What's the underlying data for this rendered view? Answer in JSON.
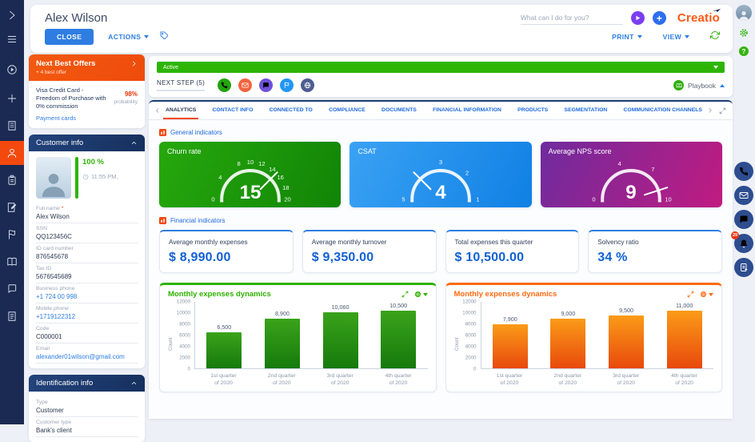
{
  "header": {
    "title": "Alex Wilson",
    "close_label": "CLOSE",
    "actions_label": "ACTIONS",
    "search_placeholder": "What can I do for you?",
    "logo_text": "Creatio",
    "print_label": "PRINT",
    "view_label": "VIEW"
  },
  "sidebar": {
    "icons": [
      "chevron-right-icon",
      "menu-icon",
      "process-play-icon",
      "add-plus-icon",
      "company-icon",
      "contact-person-icon",
      "tasks-clipboard-icon",
      "edit-document-icon",
      "flag-icon",
      "knowledge-book-icon",
      "chat-bubbles-icon",
      "invoice-file-icon"
    ],
    "active_index": 5
  },
  "right_rail": {
    "comm_icons": [
      "call-icon",
      "email-icon",
      "chat-icon",
      "notifications-bell-icon",
      "task-file-icon"
    ],
    "notification_count": "29"
  },
  "next_best_offers": {
    "title": "Next Best Offers",
    "subtitle": "+ 4 best offer",
    "offer_text": "Visa Credit Card - Freedom of Purchase with 0% commission",
    "probability_value": "98",
    "probability_unit": "%",
    "probability_label": "probability",
    "category_link": "Payment cards"
  },
  "customer_info": {
    "title": "Customer info",
    "completeness": "100 %",
    "timestamp": "11:55 PM,",
    "fields": [
      {
        "label": "Full name",
        "value": "Alex Wilson",
        "required": true
      },
      {
        "label": "SSN",
        "value": "QQ123456C"
      },
      {
        "label": "ID card number",
        "value": "876545678"
      },
      {
        "label": "Tax ID",
        "value": "5676545689"
      },
      {
        "label": "Business phone",
        "value": "+1 724 00 998",
        "link": true
      },
      {
        "label": "Mobile phone",
        "value": "+1719122312",
        "link": true
      },
      {
        "label": "Code",
        "value": "C000001"
      },
      {
        "label": "Email",
        "value": "alexander01wilson@gmail.com",
        "link": true
      }
    ]
  },
  "identification_info": {
    "title": "Identification info",
    "fields": [
      {
        "label": "Type",
        "value": "Customer"
      },
      {
        "label": "Customer type",
        "value": "Bank's client"
      }
    ]
  },
  "status_panel": {
    "status": "Active",
    "next_step_label": "NEXT STEP (5)",
    "step_icons": [
      "call-icon",
      "email-icon",
      "chat-icon",
      "flag-icon",
      "web-icon"
    ],
    "step_icon_colors": [
      "#23a40d",
      "#f2643f",
      "#6f52d8",
      "#2196f3",
      "#4d5d92"
    ],
    "playbook_label": "Playbook"
  },
  "tabs": {
    "items": [
      "ANALYTICS",
      "CONTACT INFO",
      "CONNECTED TO",
      "COMPLIANCE",
      "DOCUMENTS",
      "FINANCIAL INFORMATION",
      "PRODUCTS",
      "SEGMENTATION",
      "COMMUNICATION CHANNELS"
    ],
    "active_index": 0
  },
  "sections": {
    "general": "General indicators",
    "financial": "Financial indicators"
  },
  "kpis": [
    {
      "label": "Average monthly expenses",
      "value": "$ 8,990.00"
    },
    {
      "label": "Average monthly turnover",
      "value": "$ 9,350.00"
    },
    {
      "label": "Total expenses this quarter",
      "value": "$ 10,500.00"
    },
    {
      "label": "Solvency ratio",
      "value": "34 %"
    }
  ],
  "chart_data": [
    {
      "type": "gauge",
      "title": "Churn rate",
      "value": 15,
      "scale_start": 0,
      "scale_end": 20,
      "ticks": [
        {
          "label": "0",
          "frac": 0
        },
        {
          "label": "4",
          "frac": 0.2
        },
        {
          "label": "8",
          "frac": 0.4
        },
        {
          "label": "10",
          "frac": 0.5
        },
        {
          "label": "12",
          "frac": 0.6
        },
        {
          "label": "14",
          "frac": 0.7
        },
        {
          "label": "16",
          "frac": 0.8
        },
        {
          "label": "18",
          "frac": 0.9
        },
        {
          "label": "20",
          "frac": 1
        }
      ],
      "needle_frac": 0.75,
      "colors": [
        "#27a80d",
        "#118406"
      ]
    },
    {
      "type": "gauge",
      "title": "CSAT",
      "value": 4,
      "scale_start": 5,
      "scale_end": 1,
      "ticks": [
        {
          "label": "5",
          "frac": 0
        },
        {
          "label": "3",
          "frac": 0.5
        },
        {
          "label": "2",
          "frac": 0.75
        },
        {
          "label": "1",
          "frac": 1
        }
      ],
      "needle_frac": 0.25,
      "colors": [
        "#3aa2f4",
        "#1080e4"
      ]
    },
    {
      "type": "gauge",
      "title": "Average NPS score",
      "value": 9,
      "scale_start": 0,
      "scale_end": 10,
      "ticks": [
        {
          "label": "0",
          "frac": 0
        },
        {
          "label": "4",
          "frac": 0.4
        },
        {
          "label": "7",
          "frac": 0.7
        },
        {
          "label": "10",
          "frac": 1
        }
      ],
      "needle_frac": 0.9,
      "colors": [
        "#6f2b9e",
        "#c01b80"
      ]
    },
    {
      "type": "bar",
      "title": "Monthly expenses dynamics",
      "ylabel": "Count",
      "ylim": [
        0,
        12000
      ],
      "yticks": [
        0,
        2000,
        4000,
        6000,
        8000,
        10000,
        12000
      ],
      "categories": [
        "1st quarter of 2020",
        "2nd quarter of 2020",
        "3rd quarter of 2020",
        "4th quarter of 2020"
      ],
      "values": [
        6500,
        8900,
        10060,
        10500
      ],
      "value_labels": [
        "6,500",
        "8,900",
        "10,060",
        "10,500"
      ],
      "accent": "#2db200",
      "bar_colors": [
        "#3aa31a",
        "#157a0c"
      ]
    },
    {
      "type": "bar",
      "title": "Monthly expenses dynamics",
      "ylabel": "Count",
      "ylim": [
        0,
        12000
      ],
      "yticks": [
        0,
        2000,
        4000,
        6000,
        8000,
        10000,
        12000
      ],
      "categories": [
        "1st quarter of 2020",
        "2nd quarter of 2020",
        "3rd quarter of 2020",
        "4th quarter of 2020"
      ],
      "values": [
        7900,
        9000,
        9500,
        11000
      ],
      "value_labels": [
        "7,900",
        "9,000",
        "9,500",
        "11,000"
      ],
      "accent": "#ff6a13",
      "bar_colors": [
        "#fb9b18",
        "#e8490c"
      ]
    }
  ]
}
